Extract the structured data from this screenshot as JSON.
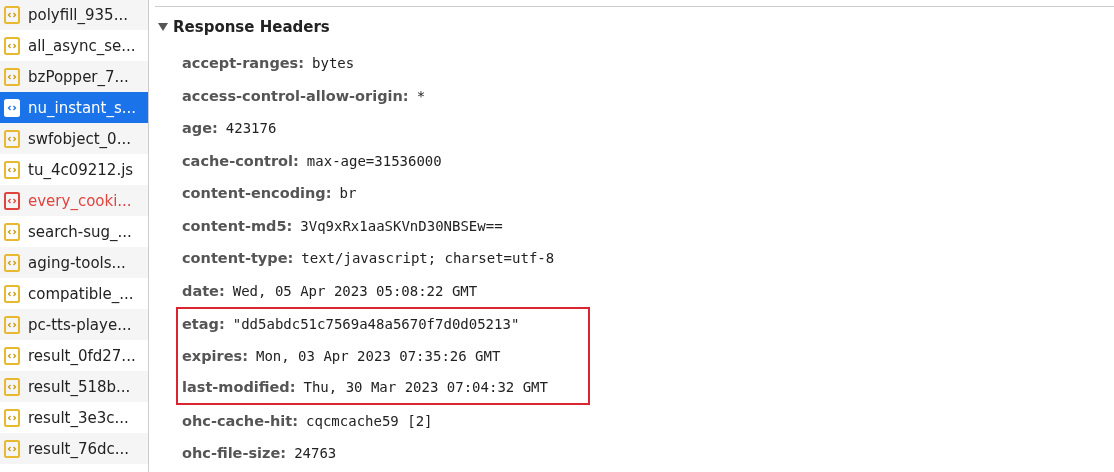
{
  "requests": [
    {
      "name": "polyfill_935...",
      "selected": false,
      "failed": false
    },
    {
      "name": "all_async_se...",
      "selected": false,
      "failed": false
    },
    {
      "name": "bzPopper_7...",
      "selected": false,
      "failed": false
    },
    {
      "name": "nu_instant_s...",
      "selected": true,
      "failed": false
    },
    {
      "name": "swfobject_0...",
      "selected": false,
      "failed": false
    },
    {
      "name": "tu_4c09212.js",
      "selected": false,
      "failed": false
    },
    {
      "name": "every_cooki...",
      "selected": false,
      "failed": true
    },
    {
      "name": "search-sug_...",
      "selected": false,
      "failed": false
    },
    {
      "name": "aging-tools...",
      "selected": false,
      "failed": false
    },
    {
      "name": "compatible_...",
      "selected": false,
      "failed": false
    },
    {
      "name": "pc-tts-playe...",
      "selected": false,
      "failed": false
    },
    {
      "name": "result_0fd27...",
      "selected": false,
      "failed": false
    },
    {
      "name": "result_518b...",
      "selected": false,
      "failed": false
    },
    {
      "name": "result_3e3c...",
      "selected": false,
      "failed": false
    },
    {
      "name": "result_76dc...",
      "selected": false,
      "failed": false
    }
  ],
  "response_headers": {
    "title": "Response Headers",
    "expanded": true,
    "headers": [
      {
        "name": "accept-ranges:",
        "value": "bytes",
        "highlighted": false
      },
      {
        "name": "access-control-allow-origin:",
        "value": "*",
        "highlighted": false
      },
      {
        "name": "age:",
        "value": "423176",
        "highlighted": false
      },
      {
        "name": "cache-control:",
        "value": "max-age=31536000",
        "highlighted": false
      },
      {
        "name": "content-encoding:",
        "value": "br",
        "highlighted": false
      },
      {
        "name": "content-md5:",
        "value": "3Vq9xRx1aaSKVnD30NBSEw==",
        "highlighted": false
      },
      {
        "name": "content-type:",
        "value": "text/javascript; charset=utf-8",
        "highlighted": false
      },
      {
        "name": "date:",
        "value": "Wed, 05 Apr 2023 05:08:22 GMT",
        "highlighted": false
      },
      {
        "name": "etag:",
        "value": "\"dd5abdc51c7569a48a5670f7d0d05213\"",
        "highlighted": true
      },
      {
        "name": "expires:",
        "value": "Mon, 03 Apr 2023 07:35:26 GMT",
        "highlighted": true
      },
      {
        "name": "last-modified:",
        "value": "Thu, 30 Mar 2023 07:04:32 GMT",
        "highlighted": true
      },
      {
        "name": "ohc-cache-hit:",
        "value": "cqcmcache59 [2]",
        "highlighted": false
      },
      {
        "name": "ohc-file-size:",
        "value": "24763",
        "highlighted": false
      }
    ]
  }
}
